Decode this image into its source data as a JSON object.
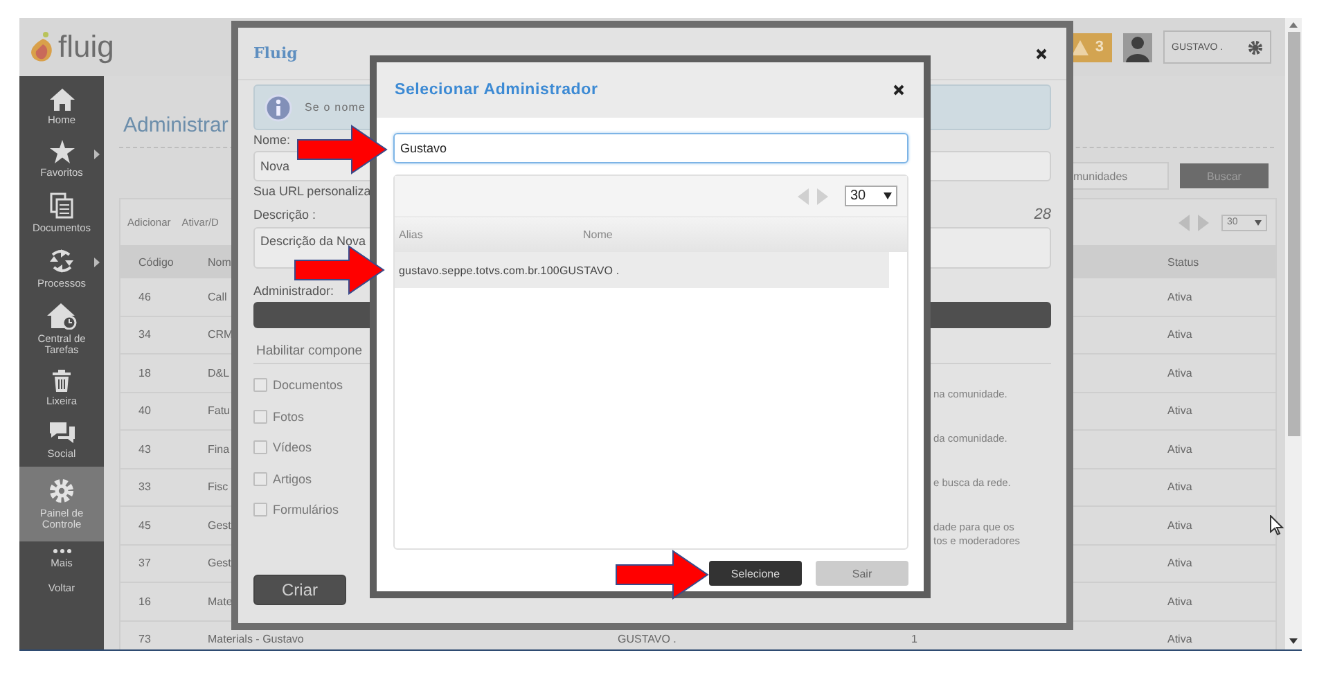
{
  "topbar": {
    "logo": "fluig",
    "alert_count": "3",
    "user": "GUSTAVO ."
  },
  "sidebar": {
    "items": [
      {
        "label": "Home",
        "kind": "home",
        "submenu": false,
        "selected": false
      },
      {
        "label": "Favoritos",
        "kind": "star",
        "submenu": true,
        "selected": false
      },
      {
        "label": "Documentos",
        "kind": "documents",
        "submenu": false,
        "selected": false
      },
      {
        "label": "Processos",
        "kind": "process",
        "submenu": true,
        "selected": false
      },
      {
        "label": "Central de Tarefas",
        "kind": "tasks",
        "submenu": false,
        "selected": false
      },
      {
        "label": "Lixeira",
        "kind": "trash",
        "submenu": false,
        "selected": false
      },
      {
        "label": "Social",
        "kind": "chat",
        "submenu": false,
        "selected": false
      },
      {
        "label": "Painel de Controle",
        "kind": "gear",
        "submenu": false,
        "selected": true
      },
      {
        "label": "Mais",
        "kind": "more",
        "submenu": false,
        "selected": false
      },
      {
        "label": "Voltar",
        "kind": "text",
        "submenu": false,
        "selected": false
      }
    ]
  },
  "page": {
    "title": "Administrar",
    "search_placeholder": "munidades",
    "search_button": "Buscar",
    "toolbar": [
      "Adicionar",
      "Ativar/D"
    ],
    "page_size": "30",
    "columns": {
      "code": "Código",
      "name": "Nom",
      "status": "Status"
    },
    "rows": [
      {
        "code": "46",
        "name": "Call",
        "status": "Ativa"
      },
      {
        "code": "34",
        "name": "CRM",
        "status": "Ativa"
      },
      {
        "code": "18",
        "name": "D&L",
        "status": "Ativa"
      },
      {
        "code": "40",
        "name": "Fatu",
        "status": "Ativa"
      },
      {
        "code": "43",
        "name": "Fina",
        "status": "Ativa"
      },
      {
        "code": "33",
        "name": "Fisc",
        "status": "Ativa"
      },
      {
        "code": "45",
        "name": "Gest",
        "status": "Ativa"
      },
      {
        "code": "37",
        "name": "Gest",
        "status": "Ativa"
      },
      {
        "code": "16",
        "name": "Mate",
        "status": "Ativa"
      },
      {
        "code": "73",
        "name": "Materials - Gustavo",
        "admin": "GUSTAVO .",
        "members": "1",
        "status": "Ativa"
      }
    ]
  },
  "community_modal": {
    "title": "Fluig",
    "info": "Se o nome",
    "name_label": "Nome:",
    "name_value": "Nova",
    "url_text": "Sua URL personaliza",
    "description_label": "Descrição :",
    "char_count": "28",
    "description_value": "Descrição da Nova",
    "admin_label": "Administrador:",
    "components_title": "Habilitar compone",
    "components": [
      {
        "label": "Documentos",
        "checked": false
      },
      {
        "label": "Fotos",
        "checked": false
      },
      {
        "label": "Vídeos",
        "checked": false
      },
      {
        "label": "Artigos",
        "checked": false
      },
      {
        "label": "Formulários",
        "checked": false
      }
    ],
    "component_notes": [
      [
        "na comunidade."
      ],
      [
        "da comunidade."
      ],
      [
        "e busca da rede."
      ],
      [
        "dade para que os",
        "tos e moderadores"
      ]
    ],
    "submit": "Criar"
  },
  "admin_modal": {
    "title": "Selecionar Administrador",
    "search_value": "Gustavo",
    "page_size": "30",
    "columns": [
      "Alias",
      "Nome"
    ],
    "rows": [
      {
        "text": "gustavo.seppe.totvs.com.br.100GUSTAVO .",
        "selected": true
      }
    ],
    "buttons": [
      {
        "label": "Selecione",
        "kind": "primary"
      },
      {
        "label": "Sair",
        "kind": "secondary"
      }
    ]
  }
}
